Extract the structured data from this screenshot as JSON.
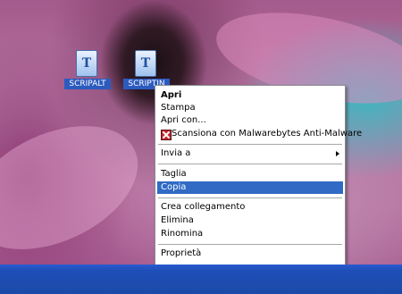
{
  "desktop": {
    "icons": [
      {
        "label": "SCRIPALT",
        "glyph": "T",
        "icon_name": "text-document-icon"
      },
      {
        "label": "SCRIPTIN",
        "glyph": "T",
        "icon_name": "text-document-icon"
      }
    ]
  },
  "context_menu": {
    "items": [
      {
        "label": "Apri",
        "bold": true
      },
      {
        "label": "Stampa"
      },
      {
        "label": "Apri con..."
      },
      {
        "label": "Scansiona con Malwarebytes Anti-Malware",
        "icon": "malwarebytes-icon"
      },
      {
        "label": "Invia a",
        "submenu": true
      },
      {
        "label": "Taglia"
      },
      {
        "label": "Copia",
        "selected": true
      },
      {
        "label": "Crea collegamento"
      },
      {
        "label": "Elimina"
      },
      {
        "label": "Rinomina"
      },
      {
        "label": "Proprietà"
      }
    ],
    "selection_color": "#316ac5"
  },
  "taskbar": {
    "color": "#1f4fb5"
  }
}
